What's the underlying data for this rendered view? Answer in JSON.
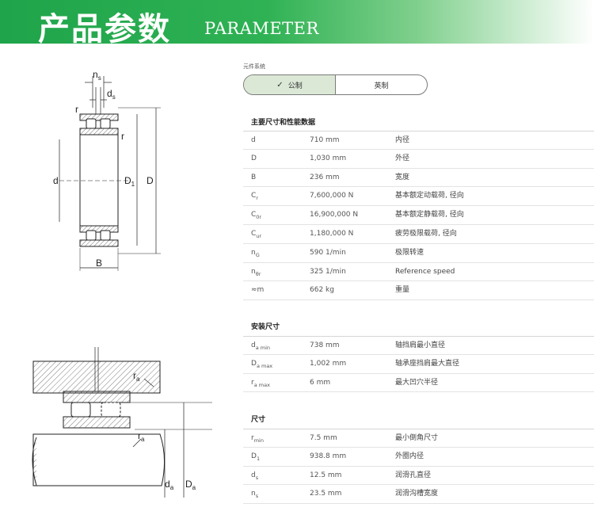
{
  "banner": {
    "title": "产品参数",
    "subtitle": "PARAMETER"
  },
  "units": {
    "label": "元件系统",
    "options": [
      {
        "label": "公制",
        "selected": true
      },
      {
        "label": "英制",
        "selected": false
      }
    ]
  },
  "sections": [
    {
      "title": "主要尺寸和性能数据",
      "rows": [
        {
          "sym": "d",
          "sub": "",
          "value": "710 mm",
          "desc": "内径"
        },
        {
          "sym": "D",
          "sub": "",
          "value": "1,030 mm",
          "desc": "外径"
        },
        {
          "sym": "B",
          "sub": "",
          "value": "236 mm",
          "desc": "宽度"
        },
        {
          "sym": "C",
          "sub": "r",
          "value": "7,600,000 N",
          "desc": "基本额定动载荷, 径向"
        },
        {
          "sym": "C",
          "sub": "0r",
          "value": "16,900,000 N",
          "desc": "基本额定静载荷, 径向"
        },
        {
          "sym": "C",
          "sub": "ur",
          "value": "1,180,000 N",
          "desc": "疲劳极限载荷, 径向"
        },
        {
          "sym": "n",
          "sub": "G",
          "value": "590 1/min",
          "desc": "极限转速"
        },
        {
          "sym": "n",
          "sub": "θr",
          "value": "325 1/min",
          "desc": "Reference speed"
        },
        {
          "sym": "≈m",
          "sub": "",
          "value": "662 kg",
          "desc": "重量"
        }
      ]
    },
    {
      "title": "安装尺寸",
      "rows": [
        {
          "sym": "d",
          "sub": "a min",
          "value": "738 mm",
          "desc": "轴挡肩最小直径"
        },
        {
          "sym": "D",
          "sub": "a max",
          "value": "1,002 mm",
          "desc": "轴承座挡肩最大直径"
        },
        {
          "sym": "r",
          "sub": "a max",
          "value": "6 mm",
          "desc": "最大凹穴半径"
        }
      ]
    },
    {
      "title": "尺寸",
      "rows": [
        {
          "sym": "r",
          "sub": "min",
          "value": "7.5 mm",
          "desc": "最小倒角尺寸"
        },
        {
          "sym": "D",
          "sub": "1",
          "value": "938.8 mm",
          "desc": "外圈内径"
        },
        {
          "sym": "d",
          "sub": "s",
          "value": "12.5 mm",
          "desc": "润滑孔直径"
        },
        {
          "sym": "n",
          "sub": "s",
          "value": "23.5 mm",
          "desc": "润滑沟槽宽度"
        }
      ]
    }
  ],
  "diagram_top": {
    "labels": {
      "ns": "n",
      "ns_sub": "s",
      "ds": "d",
      "ds_sub": "s",
      "r1": "r",
      "r2": "r",
      "d": "d",
      "D1": "D",
      "D1_sub": "1",
      "D": "D",
      "B": "B"
    }
  },
  "diagram_bottom": {
    "labels": {
      "ra": "r",
      "ra_sub": "a",
      "ra2": "r",
      "ra2_sub": "a",
      "da": "d",
      "da_sub": "a",
      "Da": "D",
      "Da_sub": "a"
    }
  }
}
